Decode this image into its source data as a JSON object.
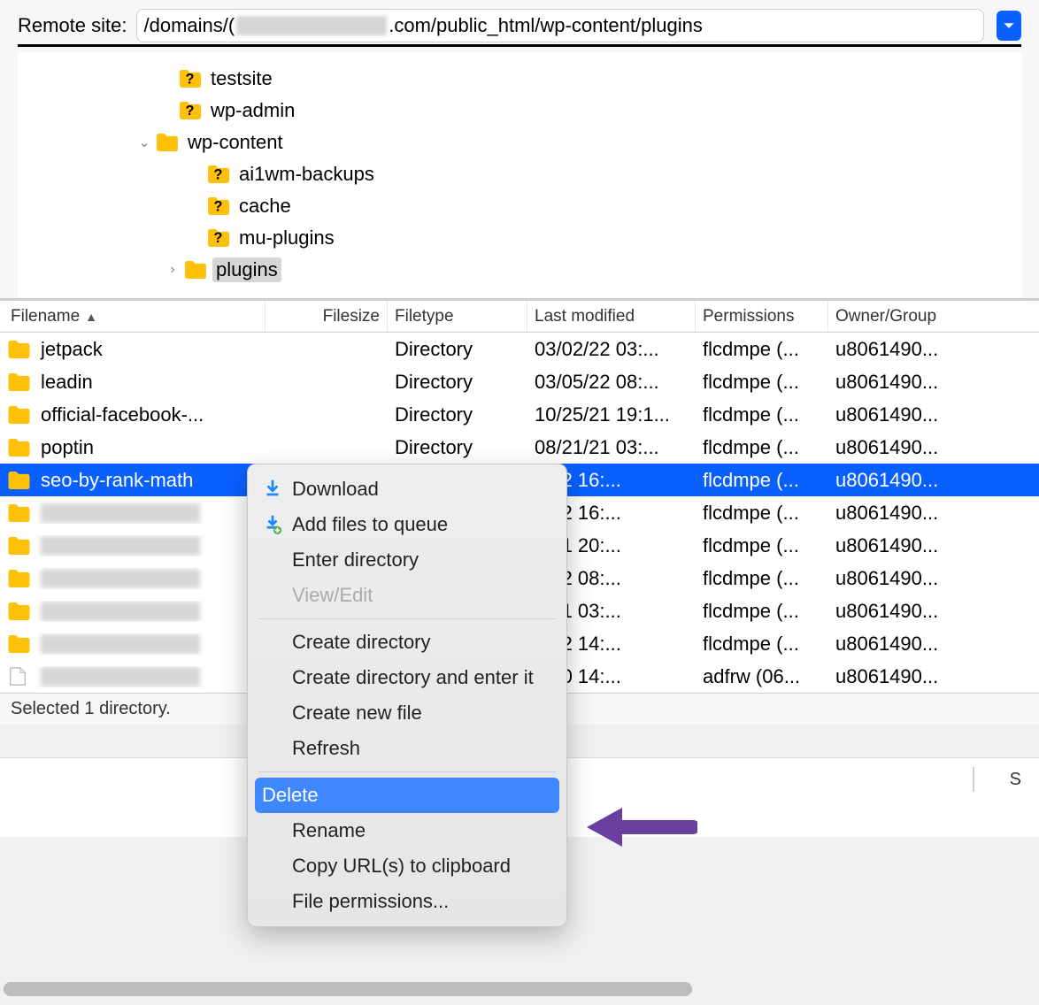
{
  "remote": {
    "label": "Remote site:",
    "path_prefix": "/domains/(",
    "path_suffix": ".com/public_html/wp-content/plugins"
  },
  "tree": {
    "items": [
      {
        "indent": 160,
        "chevron": "",
        "icon": "folder-question",
        "label": "testsite",
        "selected": false
      },
      {
        "indent": 160,
        "chevron": "",
        "icon": "folder-question",
        "label": "wp-admin",
        "selected": false
      },
      {
        "indent": 134,
        "chevron": "⌄",
        "icon": "folder",
        "label": "wp-content",
        "selected": false
      },
      {
        "indent": 192,
        "chevron": "",
        "icon": "folder-question",
        "label": "ai1wm-backups",
        "selected": false
      },
      {
        "indent": 192,
        "chevron": "",
        "icon": "folder-question",
        "label": "cache",
        "selected": false
      },
      {
        "indent": 192,
        "chevron": "",
        "icon": "folder-question",
        "label": "mu-plugins",
        "selected": false
      },
      {
        "indent": 166,
        "chevron": "›",
        "icon": "folder",
        "label": "plugins",
        "selected": true
      }
    ]
  },
  "columns": {
    "filename": "Filename",
    "filesize": "Filesize",
    "filetype": "Filetype",
    "lastmodified": "Last modified",
    "permissions": "Permissions",
    "owner": "Owner/Group"
  },
  "rows": [
    {
      "name": "jetpack",
      "redacted": false,
      "type": "Directory",
      "date": "03/02/22 03:...",
      "perm": "flcdmpe (...",
      "owner": "u8061490...",
      "selected": false,
      "icon": "folder"
    },
    {
      "name": "leadin",
      "redacted": false,
      "type": "Directory",
      "date": "03/05/22 08:...",
      "perm": "flcdmpe (...",
      "owner": "u8061490...",
      "selected": false,
      "icon": "folder"
    },
    {
      "name": "official-facebook-...",
      "redacted": false,
      "type": "Directory",
      "date": "10/25/21 19:1...",
      "perm": "flcdmpe (...",
      "owner": "u8061490...",
      "selected": false,
      "icon": "folder"
    },
    {
      "name": "poptin",
      "redacted": false,
      "type": "Directory",
      "date": "08/21/21 03:...",
      "perm": "flcdmpe (...",
      "owner": "u8061490...",
      "selected": false,
      "icon": "folder"
    },
    {
      "name": "seo-by-rank-math",
      "redacted": false,
      "type": "",
      "date": "7/22 16:...",
      "perm": "flcdmpe (...",
      "owner": "u8061490...",
      "selected": true,
      "icon": "folder"
    },
    {
      "name": "",
      "redacted": true,
      "type": "",
      "date": "7/22 16:...",
      "perm": "flcdmpe (...",
      "owner": "u8061490...",
      "selected": false,
      "icon": "folder"
    },
    {
      "name": "",
      "redacted": true,
      "type": "",
      "date": "3/21 20:...",
      "perm": "flcdmpe (...",
      "owner": "u8061490...",
      "selected": false,
      "icon": "folder"
    },
    {
      "name": "",
      "redacted": true,
      "type": "",
      "date": "5/22 08:...",
      "perm": "flcdmpe (...",
      "owner": "u8061490...",
      "selected": false,
      "icon": "folder"
    },
    {
      "name": "",
      "redacted": true,
      "type": "",
      "date": "8/21 03:...",
      "perm": "flcdmpe (...",
      "owner": "u8061490...",
      "selected": false,
      "icon": "folder"
    },
    {
      "name": "",
      "redacted": true,
      "type": "",
      "date": "7/22 14:...",
      "perm": "flcdmpe (...",
      "owner": "u8061490...",
      "selected": false,
      "icon": "folder"
    },
    {
      "name": "",
      "redacted": true,
      "type": "",
      "date": "3/20 14:...",
      "perm": "adfrw (06...",
      "owner": "u8061490...",
      "selected": false,
      "icon": "file"
    }
  ],
  "status": "Selected 1 directory.",
  "bottom": {
    "header_fragment": "S"
  },
  "context_menu": {
    "download": "Download",
    "add_to_queue": "Add files to queue",
    "enter_directory": "Enter directory",
    "view_edit": "View/Edit",
    "create_directory": "Create directory",
    "create_directory_enter": "Create directory and enter it",
    "create_new_file": "Create new file",
    "refresh": "Refresh",
    "delete": "Delete",
    "rename": "Rename",
    "copy_urls": "Copy URL(s) to clipboard",
    "file_permissions": "File permissions..."
  }
}
